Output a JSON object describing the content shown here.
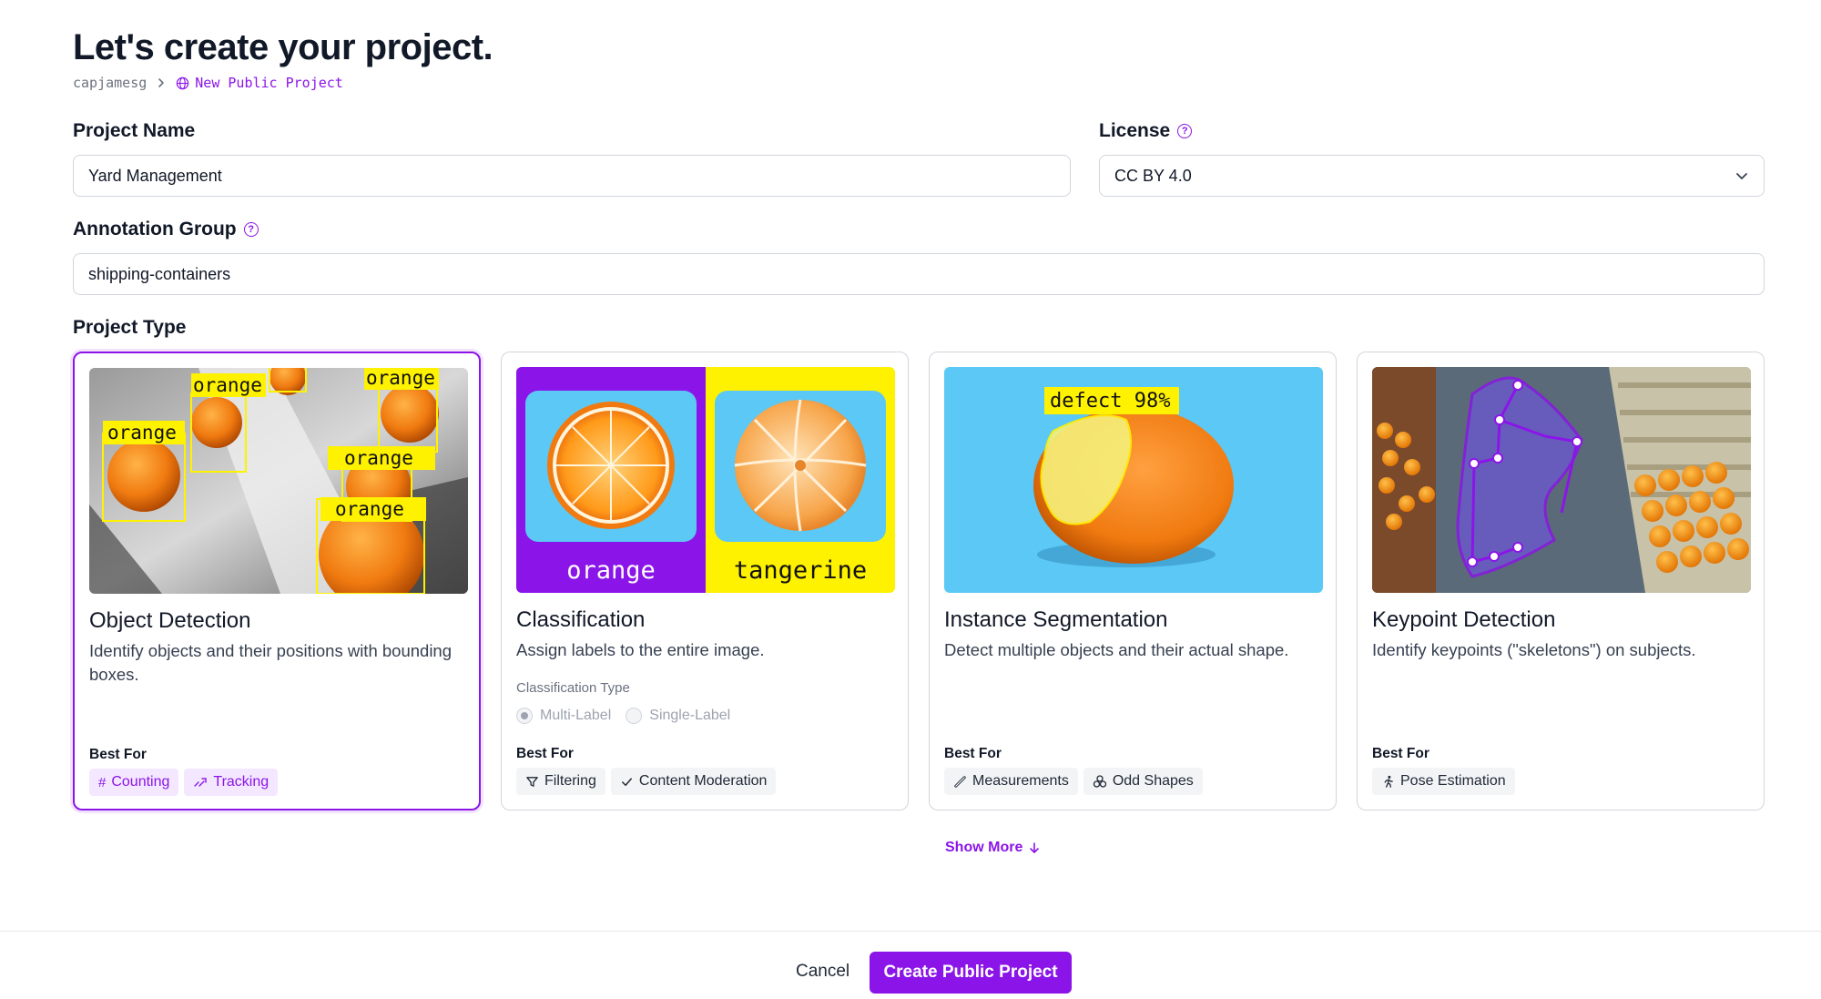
{
  "header": {
    "title": "Let's create your project.",
    "breadcrumb_user": "capjamesg",
    "breadcrumb_project": "New Public Project"
  },
  "form": {
    "project_name_label": "Project Name",
    "project_name_value": "Yard Management",
    "license_label": "License",
    "license_value": "CC BY 4.0",
    "annotation_group_label": "Annotation Group",
    "annotation_group_value": "shipping-containers",
    "project_type_label": "Project Type"
  },
  "cards": [
    {
      "title": "Object Detection",
      "description": "Identify objects and their positions with bounding boxes.",
      "best_for_label": "Best For",
      "thumb_labels": [
        "orange",
        "orange",
        "orange",
        "orange",
        "orange"
      ],
      "tags": [
        {
          "label": "Counting",
          "icon": "hash-icon"
        },
        {
          "label": "Tracking",
          "icon": "tracking-icon"
        }
      ],
      "selected": true
    },
    {
      "title": "Classification",
      "description": "Assign labels to the entire image.",
      "classification_type_label": "Classification Type",
      "radio_options": [
        "Multi-Label",
        "Single-Label"
      ],
      "radio_selected": "Multi-Label",
      "best_for_label": "Best For",
      "thumb_labels": [
        "orange",
        "tangerine"
      ],
      "tags": [
        {
          "label": "Filtering",
          "icon": "filter-icon"
        },
        {
          "label": "Content Moderation",
          "icon": "check-icon"
        }
      ]
    },
    {
      "title": "Instance Segmentation",
      "description": "Detect multiple objects and their actual shape.",
      "best_for_label": "Best For",
      "thumb_labels": [
        "defect 98%"
      ],
      "tags": [
        {
          "label": "Measurements",
          "icon": "ruler-icon"
        },
        {
          "label": "Odd Shapes",
          "icon": "shapes-icon"
        }
      ]
    },
    {
      "title": "Keypoint Detection",
      "description": "Identify keypoints (\"skeletons\") on subjects.",
      "best_for_label": "Best For",
      "tags": [
        {
          "label": "Pose Estimation",
          "icon": "person-running-icon"
        }
      ]
    }
  ],
  "show_more_label": "Show More",
  "footer": {
    "cancel_label": "Cancel",
    "create_label": "Create Public Project"
  },
  "colors": {
    "accent": "#8b15e8",
    "label_yellow": "#fff200",
    "sky_blue": "#5bc8f5"
  }
}
